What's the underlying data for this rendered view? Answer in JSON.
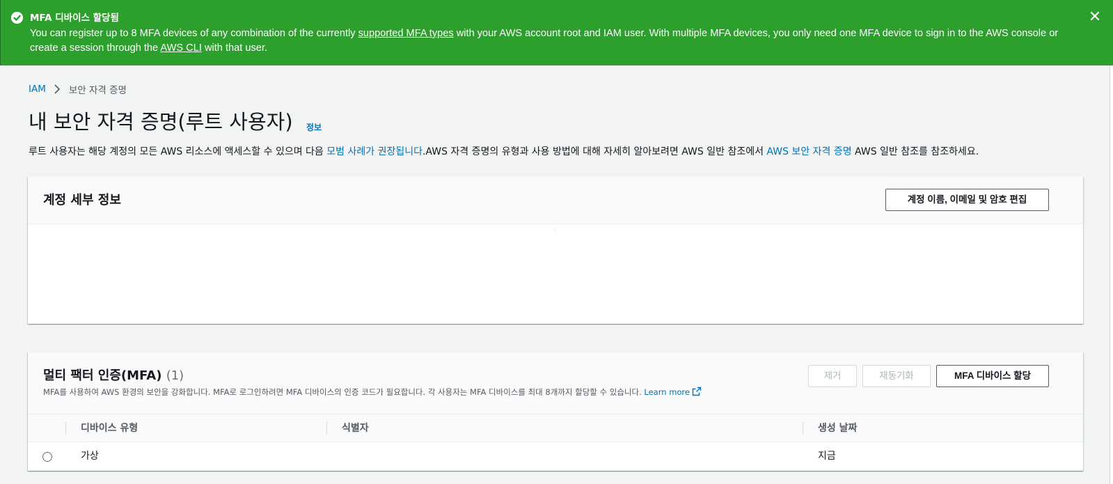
{
  "flash": {
    "title": "MFA 디바이스 할당됨",
    "text_1": "You can register up to 8 MFA devices of any combination of the currently ",
    "link_1": "supported MFA types",
    "text_2": " with your AWS account root and IAM user. With multiple MFA devices, you only need one MFA device to sign in to the AWS console or create a session through the ",
    "link_2": "AWS CLI",
    "text_3": " with that user.",
    "close_symbol": "✕",
    "color": "#2c9f2d"
  },
  "breadcrumb": {
    "root": "IAM",
    "current": "보안 자격 증명"
  },
  "page": {
    "title": "내 보안 자격 증명(루트 사용자)",
    "info": "정보",
    "desc_1": "루트 사용자는 해당 계정의 모든 AWS 리소스에 액세스할 수 있으며 다음 ",
    "desc_link_1": "모범 사례가 권장됩니다",
    "desc_2": ".AWS 자격 증명의 유형과 사용 방법에 대해 자세히 알아보려면 AWS 일반 참조에서 ",
    "desc_link_2": "AWS 보안 자격 증명",
    "desc_3": " AWS 일반 참조를 참조하세요."
  },
  "account": {
    "title": "계정 세부 정보",
    "edit_button": "계정 이름, 이메일 및 암호 편집"
  },
  "mfa": {
    "title": "멀티 팩터 인증(MFA)",
    "count": "(1)",
    "desc": "MFA를 사용하여 AWS 환경의 보안을 강화합니다. MFA로 로그인하려면 MFA 디바이스의 인증 코드가 필요합니다. 각 사용자는 MFA 디바이스를 최대 8개까지 할당할 수 있습니다. ",
    "learn_more": "Learn more",
    "remove_button": "제거",
    "resync_button": "재동기화",
    "assign_button": "MFA 디바이스 할당",
    "columns": [
      "디바이스 유형",
      "식별자",
      "생성 날짜"
    ],
    "rows": [
      {
        "type": "가상",
        "identifier": "",
        "created": "지금"
      }
    ]
  },
  "colors": {
    "link": "#0073bb",
    "success": "#2c9f2d",
    "background": "#f2f3f3"
  },
  "icons": {
    "flash": "check-circle-icon",
    "close": "close-icon",
    "breadcrumb": "chevron-right-icon",
    "external": "external-link-icon"
  }
}
